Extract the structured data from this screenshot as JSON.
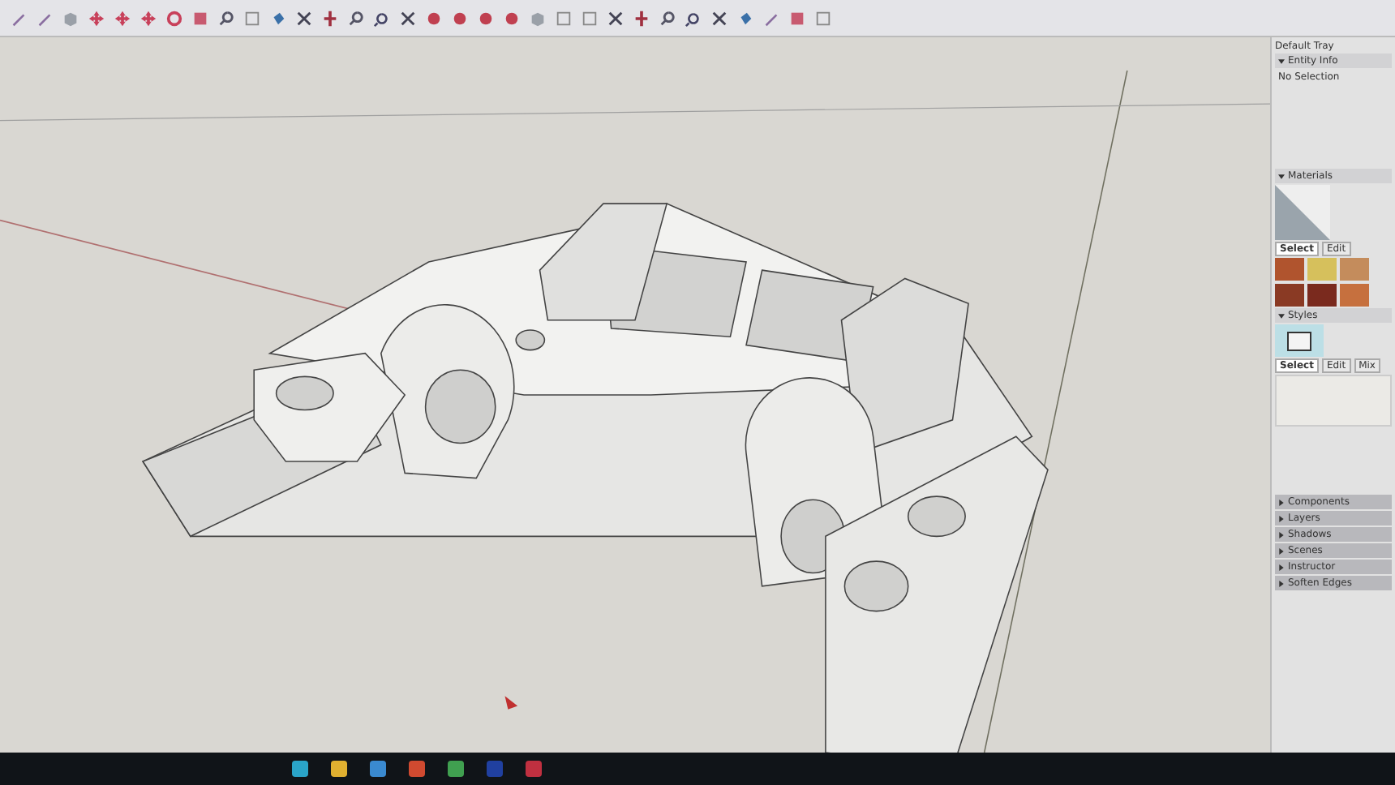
{
  "tray": {
    "title": "Default Tray",
    "entity_info": {
      "title": "Entity Info",
      "expanded": true,
      "value": "No Selection"
    },
    "materials": {
      "title": "Materials",
      "expanded": true,
      "tabs": [
        {
          "label": "Select",
          "selected": true
        },
        {
          "label": "Edit",
          "selected": false
        }
      ],
      "swatches": [
        {
          "color": "#b0542e"
        },
        {
          "color": "#d6c05c"
        },
        {
          "color": "#c48c5c"
        },
        {
          "color": "#8a3a24"
        },
        {
          "color": "#7a2a1e"
        },
        {
          "color": "#c6703e"
        }
      ]
    },
    "styles": {
      "title": "Styles",
      "expanded": true,
      "tabs": [
        {
          "label": "Select",
          "selected": true
        },
        {
          "label": "Edit",
          "selected": false
        },
        {
          "label": "Mix",
          "selected": false
        }
      ]
    },
    "collapsed_panels": [
      {
        "title": "Components",
        "expanded": false
      },
      {
        "title": "Layers",
        "expanded": false
      },
      {
        "title": "Shadows",
        "expanded": false
      },
      {
        "title": "Scenes",
        "expanded": false
      },
      {
        "title": "Instructor",
        "expanded": false
      },
      {
        "title": "Soften Edges",
        "expanded": false
      }
    ]
  }
}
